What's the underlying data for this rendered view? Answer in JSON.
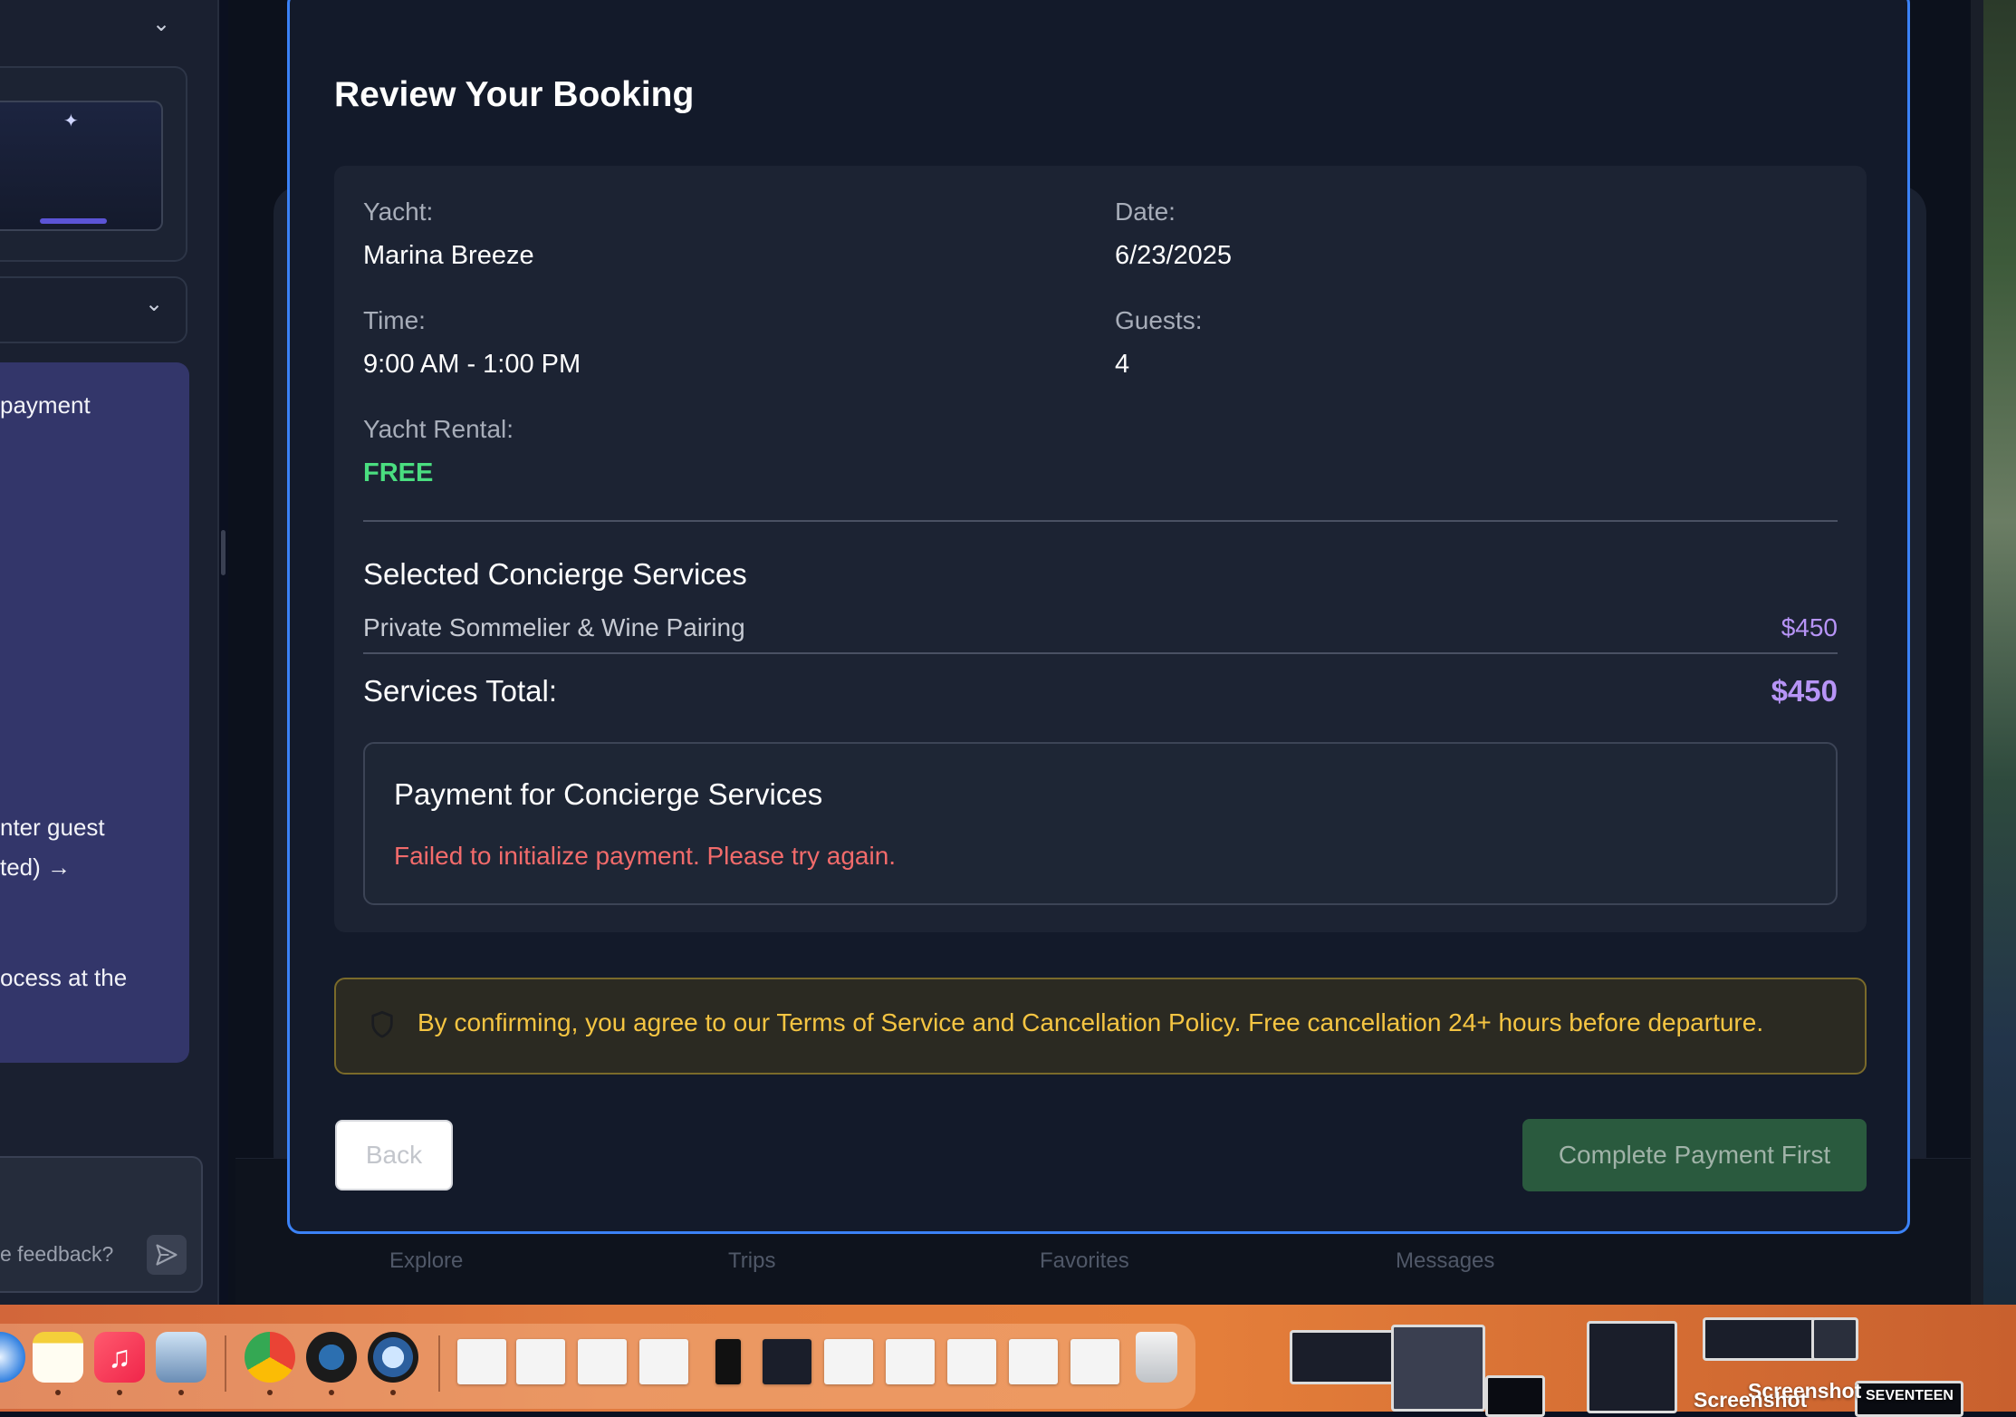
{
  "assistant_panel": {
    "message_fragments": [
      "payment",
      "nter guest",
      "ted) →",
      "ocess at the"
    ],
    "input_placeholder": "e feedback?"
  },
  "bottom_tabs": [
    "Explore",
    "Trips",
    "Favorites",
    "Messages"
  ],
  "modal": {
    "title": "Review Your Booking",
    "yacht_label": "Yacht:",
    "yacht_value": "Marina Breeze",
    "date_label": "Date:",
    "date_value": "6/23/2025",
    "time_label": "Time:",
    "time_value": "9:00 AM - 1:00 PM",
    "guests_label": "Guests:",
    "guests_value": "4",
    "rental_label": "Yacht Rental:",
    "rental_value": "FREE",
    "services_title": "Selected Concierge Services",
    "services": [
      {
        "name": "Private Sommelier & Wine Pairing",
        "price": "$450"
      }
    ],
    "services_total_label": "Services Total:",
    "services_total_value": "$450",
    "payment_title": "Payment for Concierge Services",
    "payment_error": "Failed to initialize payment. Please try again.",
    "terms_text": "By confirming, you agree to our Terms of Service and Cancellation Policy. Free cancellation 24+ hours before departure.",
    "back_label": "Back",
    "complete_label": "Complete Payment First"
  },
  "dock": {
    "apps": [
      "safari",
      "notes",
      "music",
      "preview",
      "chrome",
      "xcode-instruments",
      "quicktime",
      "files",
      "trash"
    ],
    "desktop_labels": [
      "Screenshot",
      "Screenshot",
      "SEVENTEEN"
    ]
  },
  "colors": {
    "accent_border": "#3b82f6",
    "free_green": "#4ade80",
    "price_purple": "#b794f6",
    "error_red": "#f26b6b",
    "warning_yellow": "#f5c542"
  }
}
